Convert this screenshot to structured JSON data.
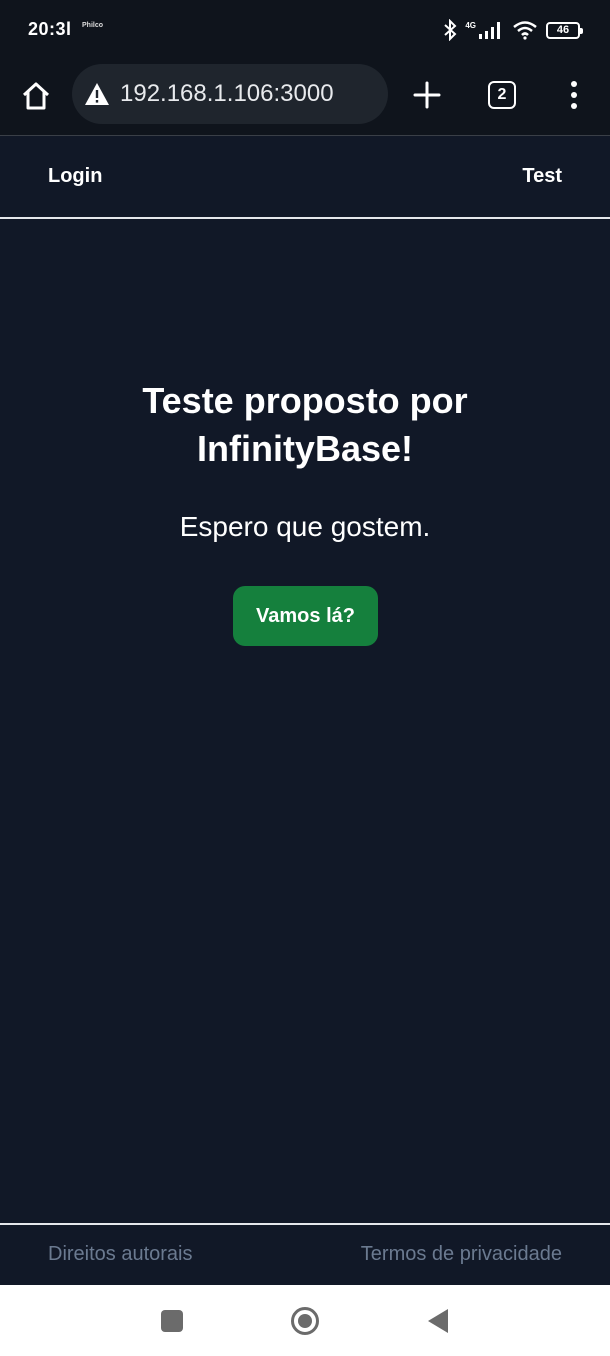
{
  "status": {
    "time": "20:3l",
    "brand": "Philco",
    "network": "4G",
    "battery": "46",
    "icons": [
      "bluetooth-icon",
      "signal-icon",
      "wifi-icon",
      "battery-icon"
    ]
  },
  "browser": {
    "url": "192.168.1.106:3000",
    "tab_count": "2",
    "icons": [
      "home-icon",
      "warning-icon",
      "plus-icon",
      "kebab-menu-icon"
    ]
  },
  "nav": {
    "login_label": "Login",
    "test_label": "Test"
  },
  "main": {
    "heading_line1": "Teste proposto por",
    "heading_line2": "InfinityBase!",
    "subtitle": "Espero que gostem.",
    "cta_label": "Vamos lá?"
  },
  "footer": {
    "copyright_label": "Direitos autorais",
    "privacy_label": "Termos de privacidade"
  },
  "colors": {
    "background": "#111827",
    "cta": "#15803d",
    "footer_text": "#6b7a90"
  }
}
